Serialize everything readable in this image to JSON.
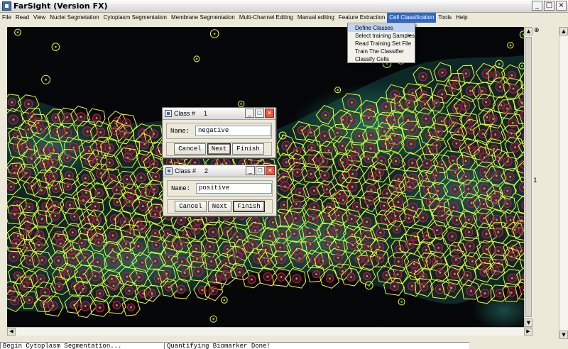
{
  "window": {
    "title": "FarSight (Version FX)",
    "buttons": [
      "_",
      "□",
      "×"
    ]
  },
  "menu": {
    "items": [
      "File",
      "Read",
      "View",
      "Nuclei Segmetation",
      "Cytoplasm Segmentation",
      "Membrane Segmentation",
      "Multi-Channel Editing",
      "Manual editing",
      "Feature Extraction",
      "Cell Classification",
      "Tools",
      "Help"
    ],
    "active": "Cell Classification"
  },
  "dropdown": {
    "items": [
      "Define Classes",
      "Select training Samples",
      "Read Training Set File",
      "Train The Classifier",
      "Classify Cells"
    ],
    "highlighted": "Define Classes",
    "submenu_arrow": "▸"
  },
  "dialogs": [
    {
      "title_label": "Class #",
      "title_number": "1",
      "name_label": "Name:",
      "name_value": "negative",
      "buttons": [
        "Cancel",
        "Next",
        "Finish"
      ],
      "focused_button": "Next"
    },
    {
      "title_label": "Class #",
      "title_number": "2",
      "name_label": "Name:",
      "name_value": "positive",
      "buttons": [
        "Cancel",
        "Next",
        "Finish"
      ],
      "focused_button": "Finish"
    }
  ],
  "scroll": {
    "up": "▲",
    "down": "▼",
    "left": "◀",
    "right": "▶"
  },
  "right_panel": {
    "label": "1",
    "pin": "⊕"
  },
  "status": {
    "left": "Begin Cytoplasm Segmentation...",
    "right": "Quantifying Biomarker Done!"
  },
  "colors": {
    "membrane": "#f5f534",
    "nucleus_outline": "#d2144e",
    "nucleus_center": "#2ee82e",
    "tissue": "#1f8f78",
    "menu_highlight": "#3168c5"
  }
}
